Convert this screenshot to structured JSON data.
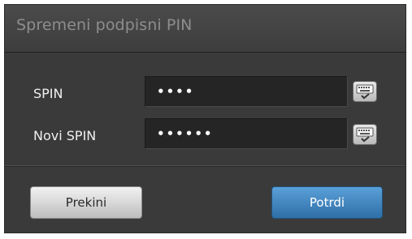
{
  "dialog": {
    "title": "Spremeni podpisni PIN",
    "fields": [
      {
        "label": "SPIN",
        "value": "••••"
      },
      {
        "label": "Novi SPIN",
        "value": "••••••"
      }
    ],
    "keyboard_icon": "virtual-keyboard-icon",
    "buttons": {
      "cancel": "Prekini",
      "confirm": "Potrdi"
    },
    "colors": {
      "confirm_button": "#3a7fbf",
      "background": "#3a3a3a"
    }
  }
}
